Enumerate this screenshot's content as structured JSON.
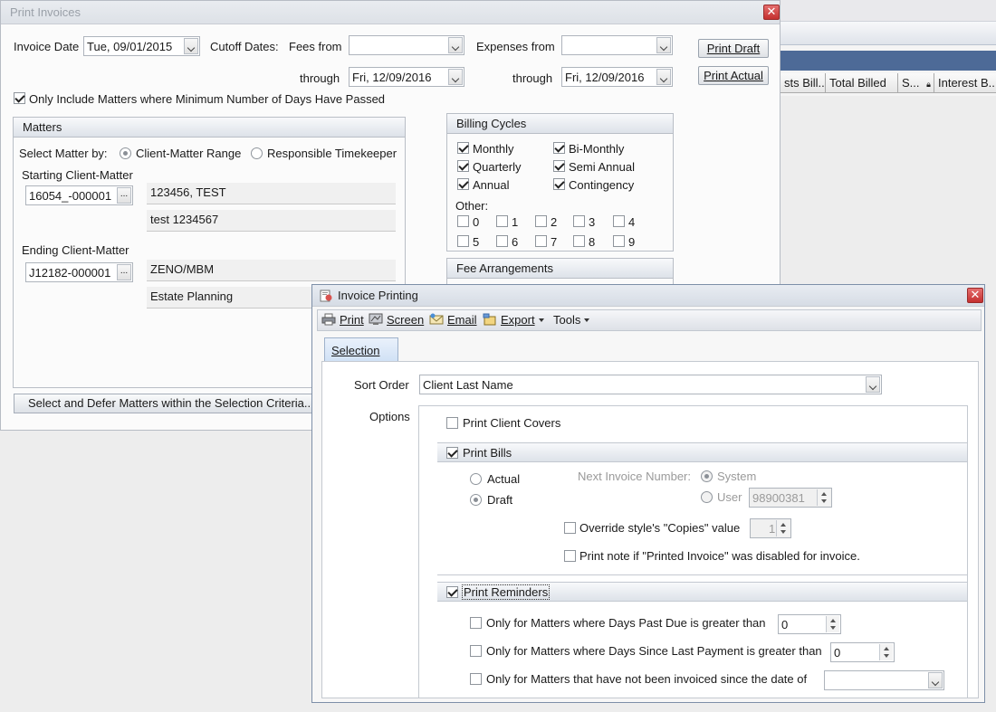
{
  "bg_grid": {
    "columns": [
      "sts Bill...",
      "Total Billed",
      "S...",
      "Interest B..."
    ]
  },
  "print_invoices": {
    "title": "Print Invoices",
    "invoice_date_label": "Invoice Date",
    "invoice_date_value": "Tue, 09/01/2015",
    "cutoff_label": "Cutoff Dates:",
    "fees_from_label": "Fees from",
    "fees_from_value": "",
    "expenses_from_label": "Expenses from",
    "expenses_from_value": "",
    "through_label": "through",
    "fees_through_value": "Fri, 12/09/2016",
    "expenses_through_value": "Fri, 12/09/2016",
    "print_draft": "Print Draft",
    "print_actual": "Print Actual",
    "min_days_label": "Only Include Matters where Minimum Number of Days Have Passed",
    "min_days_checked": true,
    "matters": {
      "header": "Matters",
      "select_by_label": "Select Matter by:",
      "opt_range": "Client-Matter Range",
      "opt_timekeeper": "Responsible Timekeeper",
      "selected_option": "range",
      "starting_label": "Starting Client-Matter",
      "starting_value": "16054_-000001",
      "starting_client": "123456, TEST",
      "starting_matter": "test 1234567",
      "ending_label": "Ending Client-Matter",
      "ending_value": "J12182-000001",
      "ending_client": "ZENO/MBM",
      "ending_matter": "Estate Planning"
    },
    "billing_cycles": {
      "header": "Billing Cycles",
      "items": [
        {
          "label": "Monthly",
          "checked": true
        },
        {
          "label": "Bi-Monthly",
          "checked": true
        },
        {
          "label": "Quarterly",
          "checked": true
        },
        {
          "label": "Semi Annual",
          "checked": true
        },
        {
          "label": "Annual",
          "checked": true
        },
        {
          "label": "Contingency",
          "checked": true
        }
      ],
      "other_label": "Other:",
      "other": [
        "0",
        "1",
        "2",
        "3",
        "4",
        "5",
        "6",
        "7",
        "8",
        "9"
      ]
    },
    "fee_arrangements_header": "Fee Arrangements",
    "defer_button": "Select and Defer Matters within the Selection Criteria..."
  },
  "invoice_printing": {
    "title": "Invoice Printing",
    "toolbar": {
      "print": "Print",
      "screen": "Screen",
      "email": "Email",
      "export": "Export",
      "tools": "Tools"
    },
    "tab_selection": "Selection",
    "sort_order_label": "Sort Order",
    "sort_order_value": "Client Last Name",
    "options_label": "Options",
    "print_client_covers": "Print Client Covers",
    "print_bills": "Print Bills",
    "actual_label": "Actual",
    "draft_label": "Draft",
    "next_invoice_label": "Next Invoice Number:",
    "system_label": "System",
    "user_label": "User",
    "user_number": "98900381",
    "override_copies": "Override style's \"Copies\" value",
    "copies_value": "1",
    "print_note": "Print note if \"Printed Invoice\" was disabled for invoice.",
    "print_reminders": "Print Reminders",
    "days_past_due": "Only for Matters where Days Past Due is greater than",
    "days_past_due_value": "0",
    "days_since_payment": "Only for Matters where Days Since Last Payment is greater than",
    "days_since_payment_value": "0",
    "not_invoiced_since": "Only for Matters that have not been invoiced since the date of",
    "not_invoiced_since_value": ""
  }
}
